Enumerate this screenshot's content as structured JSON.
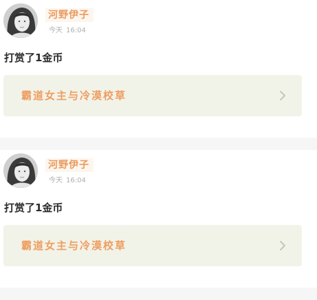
{
  "feed": [
    {
      "username": "河野伊子",
      "day": "今天",
      "time": "16:04",
      "action": "打赏了1金币",
      "book_title": "霸道女主与冷漠校草"
    },
    {
      "username": "河野伊子",
      "day": "今天",
      "time": "16:04",
      "action": "打赏了1金币",
      "book_title": "霸道女主与冷漠校草"
    }
  ],
  "icons": {
    "chevron": "chevron-right-icon",
    "avatar": "avatar"
  },
  "colors": {
    "username": "#ea9a5e",
    "book_title": "#ee9e62",
    "book_card_bg": "#f2f3e8",
    "separator": "#f6f6f6"
  }
}
